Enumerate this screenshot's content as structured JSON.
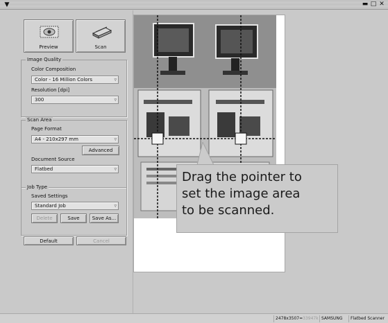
{
  "window": {
    "menu_icon": "chevron-down-icon",
    "controls": {
      "minimize": "▬",
      "maximize": "□",
      "close": "✕"
    }
  },
  "toolbar": {
    "preview_label": "Preview",
    "scan_label": "Scan"
  },
  "image_quality": {
    "title": "Image Quality",
    "color_label": "Color Composition",
    "color_value": "Color - 16 Million Colors",
    "resolution_label": "Resolution [dpi]",
    "resolution_value": "300"
  },
  "scan_area": {
    "title": "Scan Area",
    "page_format_label": "Page Format",
    "page_format_value": "A4 - 210x297 mm",
    "advanced_label": "Advanced",
    "document_source_label": "Document Source",
    "document_source_value": "Flatbed"
  },
  "job_type": {
    "title": "Job Type",
    "saved_settings_label": "Saved Settings",
    "saved_settings_value": "Standard Job",
    "delete_label": "Delete",
    "save_label": "Save",
    "save_as_label": "Save As..."
  },
  "bottom_buttons": {
    "default_label": "Default",
    "cancel_label": "Cancel"
  },
  "callout": {
    "text": "Drag the pointer to\nset the image area\nto be scanned."
  },
  "status": {
    "dimensions": "2478x3507=",
    "size": "33947k",
    "vendor": "SAMSUNG",
    "device": "Flatbed Scanner"
  },
  "colors": {
    "background": "#c9c9c9",
    "paper": "#ffffff",
    "callout_bg": "#cbcbcb"
  }
}
